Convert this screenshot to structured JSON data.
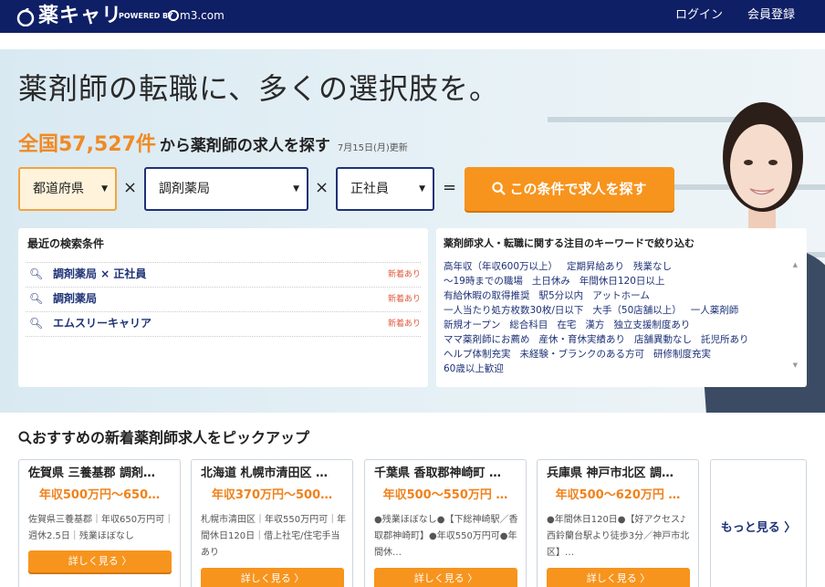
{
  "header": {
    "logo": "薬キャリ",
    "powered_by": "POWERED BY",
    "partner": "m3.com",
    "login": "ログイン",
    "register": "会員登録"
  },
  "hero": {
    "title": "薬剤師の転職に、多くの選択肢を。",
    "count_text": "全国57,527件",
    "count_suffix": "から薬剤師の求人を探す",
    "updated": "7月15日(月)更新",
    "selects": {
      "prefecture": "都道府県",
      "type": "調剤薬局",
      "employment": "正社員"
    },
    "op_times": "×",
    "op_equals": "=",
    "search_button": "この条件で求人を探す"
  },
  "recent": {
    "title": "最近の検索条件",
    "items": [
      {
        "label": "調剤薬局 × 正社員",
        "badge": "新着あり"
      },
      {
        "label": "調剤薬局",
        "badge": "新着あり"
      },
      {
        "label": "エムスリーキャリア",
        "badge": "新着あり"
      }
    ]
  },
  "keywords": {
    "title": "薬剤師求人・転職に関する注目のキーワードで絞り込む",
    "lines": [
      [
        "高年収（年収600万以上）",
        "定期昇給あり",
        "残業なし"
      ],
      [
        "～19時までの職場",
        "土日休み",
        "年間休日120日以上"
      ],
      [
        "有給休暇の取得推奨",
        "駅5分以内",
        "アットホーム"
      ],
      [
        "一人当たり処方枚数30枚/日以下",
        "大手（50店舗以上）",
        "一人薬剤師"
      ],
      [
        "新規オープン",
        "総合科目",
        "在宅",
        "漢方",
        "独立支援制度あり"
      ],
      [
        "ママ薬剤師にお薦め",
        "産休・育休実績あり",
        "店舗異動なし",
        "託児所あり"
      ],
      [
        "ヘルプ体制充実",
        "未経験・ブランクのある方可",
        "研修制度充実"
      ],
      [
        "60歳以上歓迎"
      ]
    ]
  },
  "pickup": {
    "title": "おすすめの新着薬剤師求人をピックアップ",
    "button": "詳しく見る",
    "more": "もっと見る",
    "cards": [
      {
        "location": "佐賀県 三養基郡 調剤…",
        "salary": "年収500万円～650…",
        "desc": "佐賀県三養基郡｜年収650万円可｜週休2.5日｜残業ほぼなし"
      },
      {
        "location": "北海道 札幌市清田区 …",
        "salary": "年収370万円～500…",
        "desc": "札幌市清田区｜年収550万円可｜年間休日120日｜借上社宅/住宅手当あり"
      },
      {
        "location": "千葉県 香取郡神崎町 …",
        "salary": "年収500～550万円 …",
        "desc": "●残業ほぼなし●【下総神崎駅／香取郡神崎町】●年収550万円可●年間休…"
      },
      {
        "location": "兵庫県 神戸市北区 調…",
        "salary": "年収500～620万円 …",
        "desc": "●年間休日120日●【好アクセス♪西鈴蘭台駅より徒歩3分／神戸市北区】…"
      }
    ]
  }
}
